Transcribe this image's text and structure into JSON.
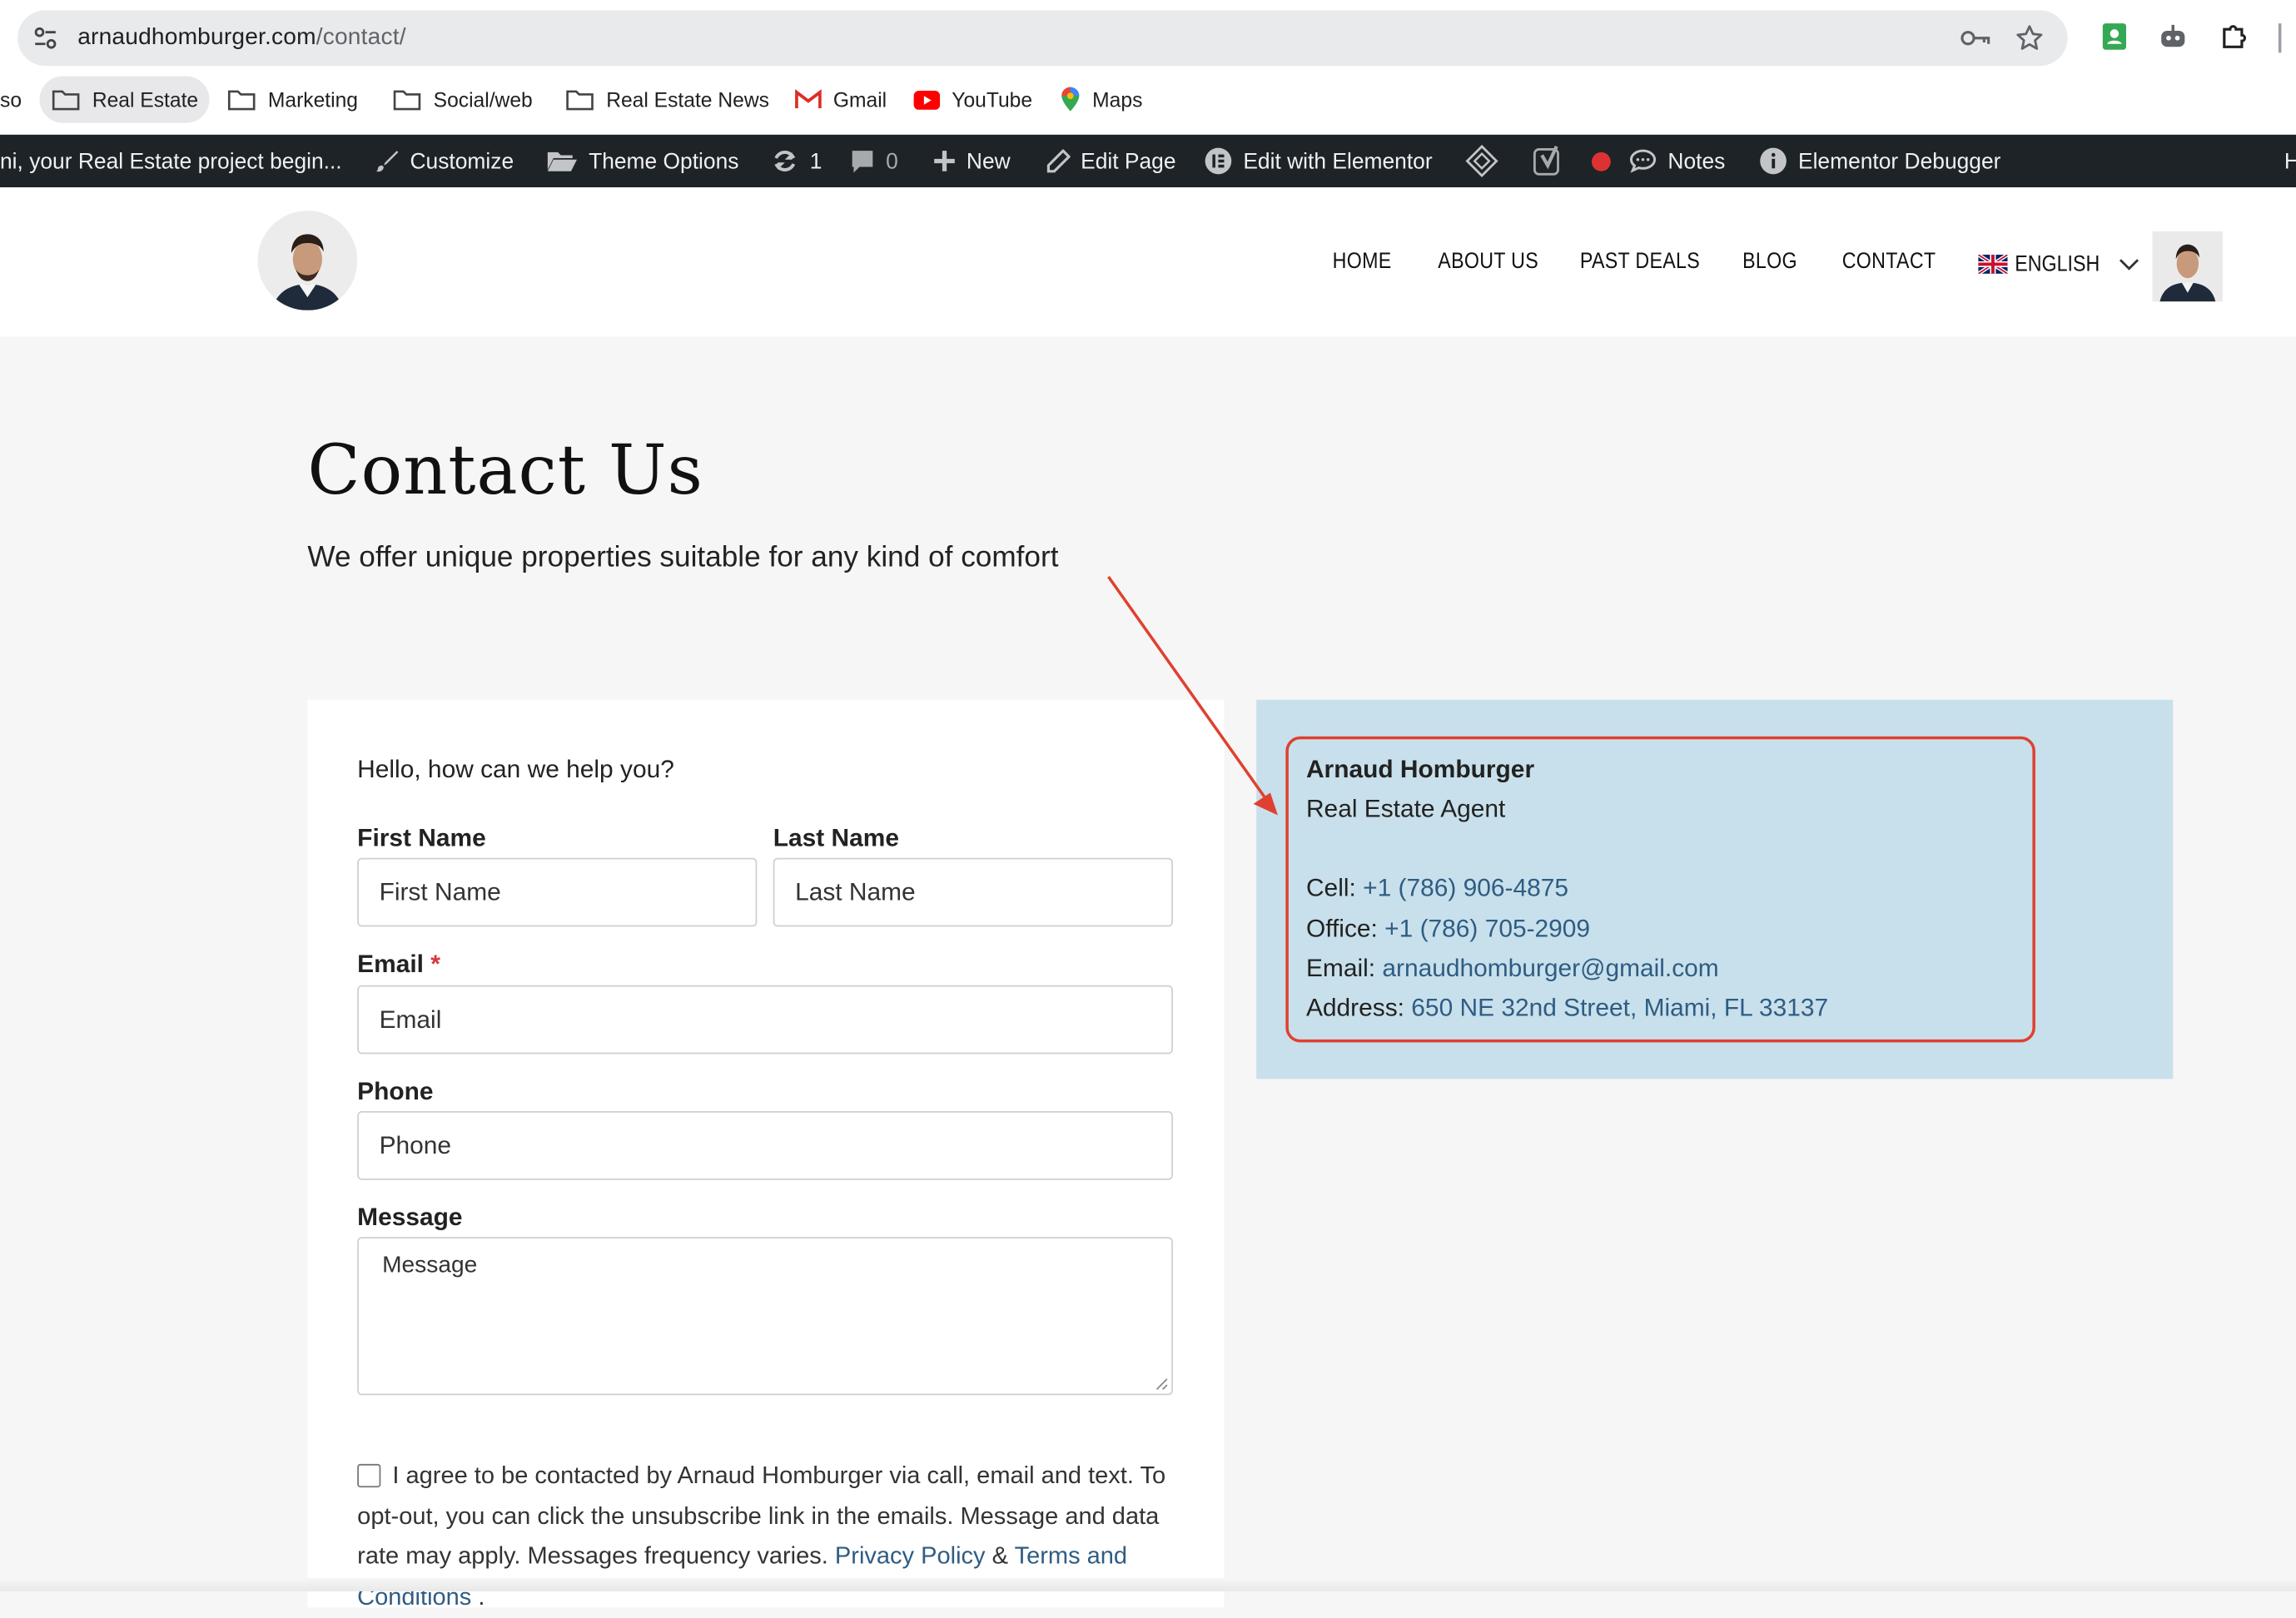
{
  "browser": {
    "url_domain": "arnaudhomburger.com",
    "url_path": "/contact/",
    "bookmarks": [
      {
        "label": "so",
        "icon": "none"
      },
      {
        "label": "Real Estate",
        "icon": "folder-icon",
        "active": true
      },
      {
        "label": "Marketing",
        "icon": "folder-icon"
      },
      {
        "label": "Social/web",
        "icon": "folder-icon"
      },
      {
        "label": "Real Estate News",
        "icon": "folder-icon"
      },
      {
        "label": "Gmail",
        "icon": "gmail-icon"
      },
      {
        "label": "YouTube",
        "icon": "youtube-icon"
      },
      {
        "label": "Maps",
        "icon": "maps-icon"
      }
    ]
  },
  "adminbar": {
    "site": "ni, your Real Estate project begin...",
    "customize": "Customize",
    "theme_options": "Theme Options",
    "updates": "1",
    "comments": "0",
    "new": "New",
    "edit_page": "Edit Page",
    "edit_elementor": "Edit with Elementor",
    "notes": "Notes",
    "debugger": "Elementor Debugger",
    "overflow": "H"
  },
  "nav": {
    "items": [
      "HOME",
      "ABOUT US",
      "PAST DEALS",
      "BLOG",
      "CONTACT"
    ],
    "language": "ENGLISH"
  },
  "hero": {
    "title": "Contact Us",
    "subtitle": "We offer unique properties suitable for any kind of comfort"
  },
  "form": {
    "intro": "Hello, how can we help you?",
    "first_name_label": "First Name",
    "first_name_placeholder": "First Name",
    "last_name_label": "Last Name",
    "last_name_placeholder": "Last Name",
    "email_label": "Email",
    "email_required": "*",
    "email_placeholder": "Email",
    "phone_label": "Phone",
    "phone_placeholder": "Phone",
    "message_label": "Message",
    "message_placeholder": "Message",
    "consent_text": "I agree to be contacted by Arnaud Homburger via call, email and text. To opt-out, you can click the unsubscribe link in the emails. Message and data rate may apply. Messages frequency varies.",
    "privacy_link": "Privacy Policy",
    "amp": "&",
    "terms_link": "Terms and Conditions",
    "period": "."
  },
  "contact_info": {
    "name": "Arnaud Homburger",
    "role": "Real Estate Agent",
    "cell_label": "Cell:",
    "cell": "+1 (786) 906-4875",
    "office_label": "Office:",
    "office": "+1 (786) 705-2909",
    "email_label": "Email:",
    "email": "arnaudhomburger@gmail.com",
    "address_label": "Address:",
    "address": "650 NE 32nd Street, Miami, FL 33137"
  },
  "colors": {
    "admin_bar": "#1d2327",
    "info_bg": "#c8e0eb",
    "annotation": "#e0402f",
    "link": "#2f5c83"
  }
}
